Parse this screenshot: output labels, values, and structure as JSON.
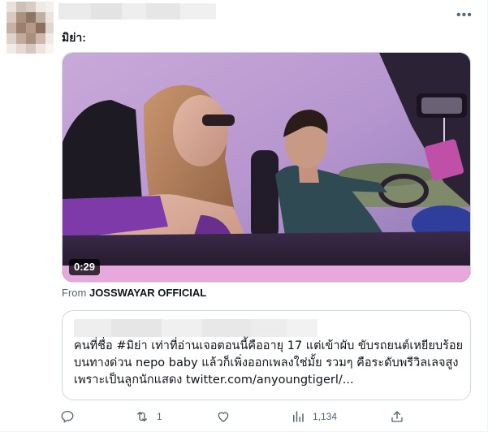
{
  "tweet": {
    "text": "มิย่า:",
    "more_icon": "more-horizontal-icon"
  },
  "media": {
    "duration": "0:29",
    "source_prefix": "From",
    "source_name": "JOSSWAYAR OFFICIAL"
  },
  "quote": {
    "text": "คนที่ชื่อ #มิย่า เท่าที่อ่านเจอตอนนี้คืออายุ 17 แต่เข้าผับ ขับรถยนต์เหยียบร้อยบนทางด่วน nepo baby แล้วก็เพิ่งออกเพลงใช่มั้ย รวมๆ คือระดับพรีวิลเลจสูงเพราะเป็นลูกนักแสดง twitter.com/anyoungtigerl/..."
  },
  "actions": {
    "reply_icon": "reply-icon",
    "retweet_icon": "retweet-icon",
    "retweet_count": "1",
    "like_icon": "like-icon",
    "views_icon": "views-icon",
    "views_count": "1,134",
    "share_icon": "share-icon"
  }
}
